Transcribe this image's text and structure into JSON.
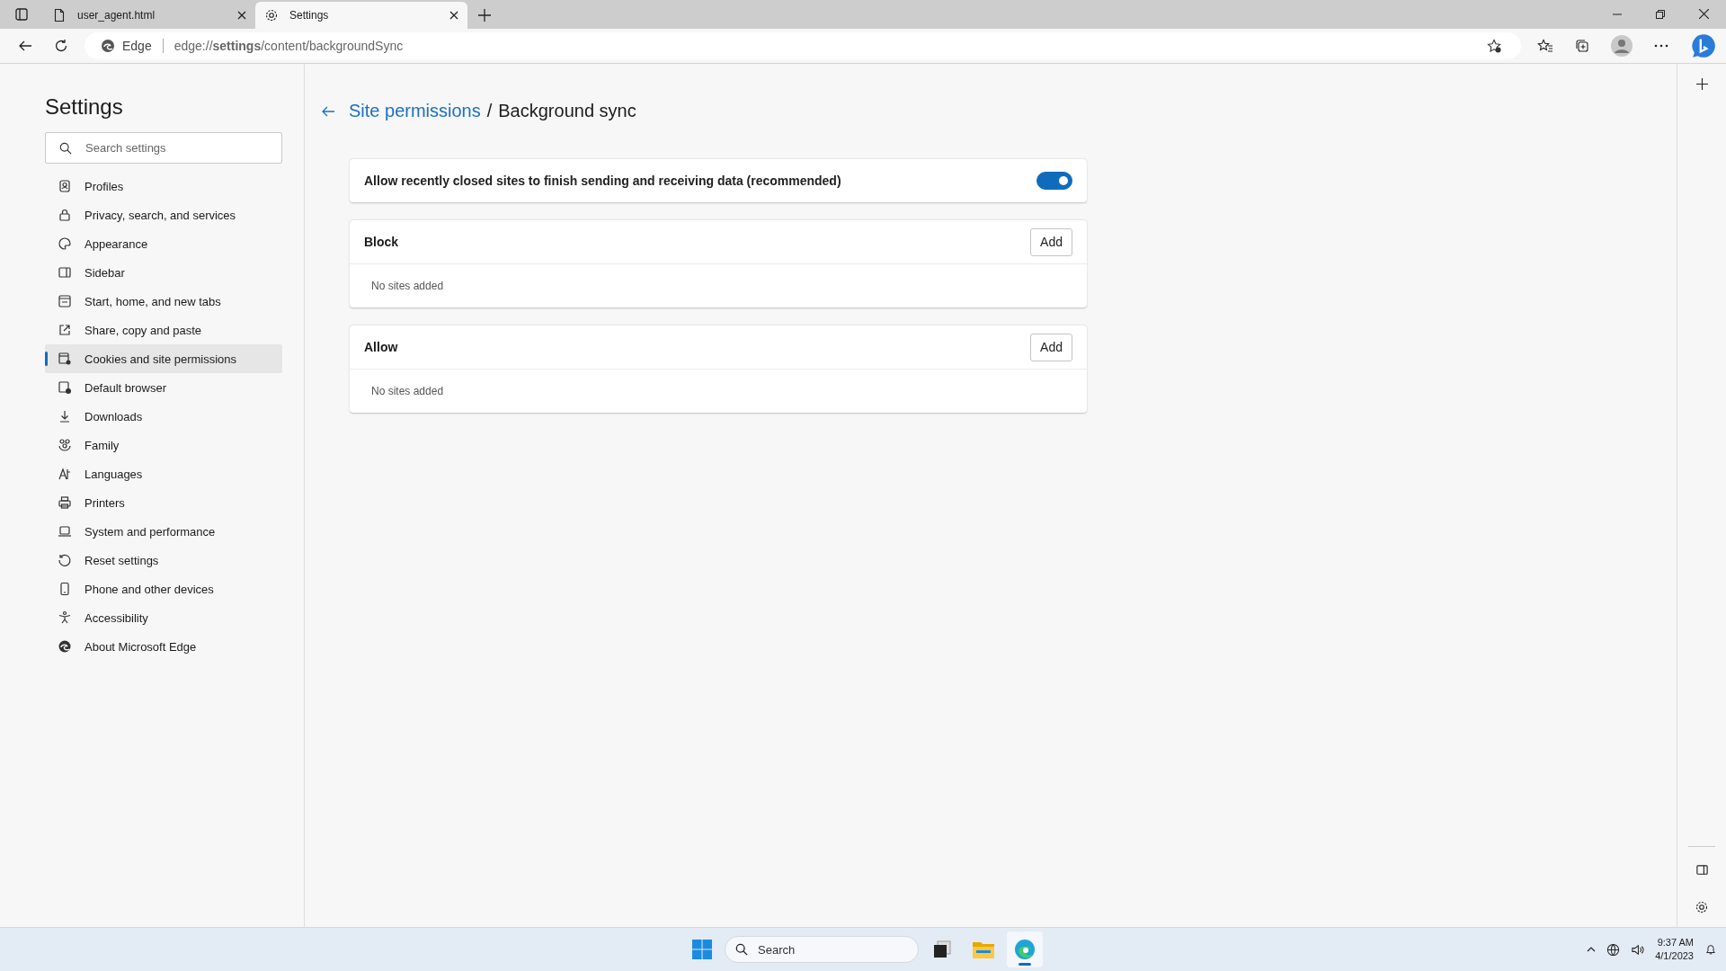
{
  "tabs": [
    {
      "title": "user_agent.html",
      "selected": false,
      "kind": "file"
    },
    {
      "title": "Settings",
      "selected": true,
      "kind": "settings"
    }
  ],
  "address_bar": {
    "site_label": "Edge",
    "url": "edge://**settings**/content/backgroundSync"
  },
  "sidebar": {
    "title": "Settings",
    "search": {
      "placeholder": "Search settings"
    },
    "items": [
      {
        "label": "Profiles",
        "selected": false
      },
      {
        "label": "Privacy, search, and services",
        "selected": false
      },
      {
        "label": "Appearance",
        "selected": false
      },
      {
        "label": "Sidebar",
        "selected": false
      },
      {
        "label": "Start, home, and new tabs",
        "selected": false
      },
      {
        "label": "Share, copy and paste",
        "selected": false
      },
      {
        "label": "Cookies and site permissions",
        "selected": true
      },
      {
        "label": "Default browser",
        "selected": false
      },
      {
        "label": "Downloads",
        "selected": false
      },
      {
        "label": "Family",
        "selected": false
      },
      {
        "label": "Languages",
        "selected": false
      },
      {
        "label": "Printers",
        "selected": false
      },
      {
        "label": "System and performance",
        "selected": false
      },
      {
        "label": "Reset settings",
        "selected": false
      },
      {
        "label": "Phone and other devices",
        "selected": false
      },
      {
        "label": "Accessibility",
        "selected": false
      },
      {
        "label": "About Microsoft Edge",
        "selected": false
      }
    ]
  },
  "breadcrumb": {
    "parent": "Site permissions",
    "separator": "/",
    "current": "Background sync"
  },
  "toggle_setting": {
    "label": "Allow recently closed sites to finish sending and receiving data (recommended)",
    "on": true
  },
  "site_lists": [
    {
      "title": "Block",
      "button": "Add",
      "empty_text": "No sites added"
    },
    {
      "title": "Allow",
      "button": "Add",
      "empty_text": "No sites added"
    }
  ],
  "taskbar": {
    "search": {
      "placeholder": "Search"
    },
    "apps": [
      {
        "kind": "task-view",
        "selected": false
      },
      {
        "kind": "folder",
        "selected": false
      },
      {
        "kind": "edge",
        "selected": true
      }
    ],
    "time": "9:37 AM",
    "date": "4/1/2023"
  }
}
